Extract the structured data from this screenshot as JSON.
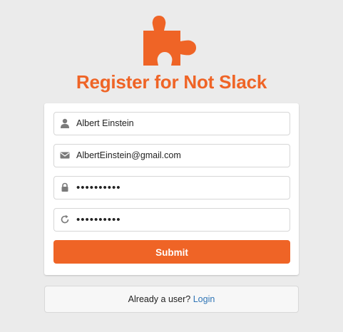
{
  "colors": {
    "accent": "#ef6426",
    "link": "#2e74b5",
    "background": "#ebebeb"
  },
  "header": {
    "logo_icon": "puzzle-piece-icon",
    "title": "Register for Not Slack"
  },
  "form": {
    "username": {
      "icon": "user-icon",
      "value": "Albert Einstein"
    },
    "email": {
      "icon": "envelope-icon",
      "value": "AlbertEinstein@gmail.com"
    },
    "password": {
      "icon": "lock-icon",
      "value": "••••••••••"
    },
    "password_confirm": {
      "icon": "repeat-icon",
      "value": "••••••••••"
    },
    "submit_label": "Submit"
  },
  "footer": {
    "prompt": "Already a user?",
    "login_link": "Login"
  }
}
